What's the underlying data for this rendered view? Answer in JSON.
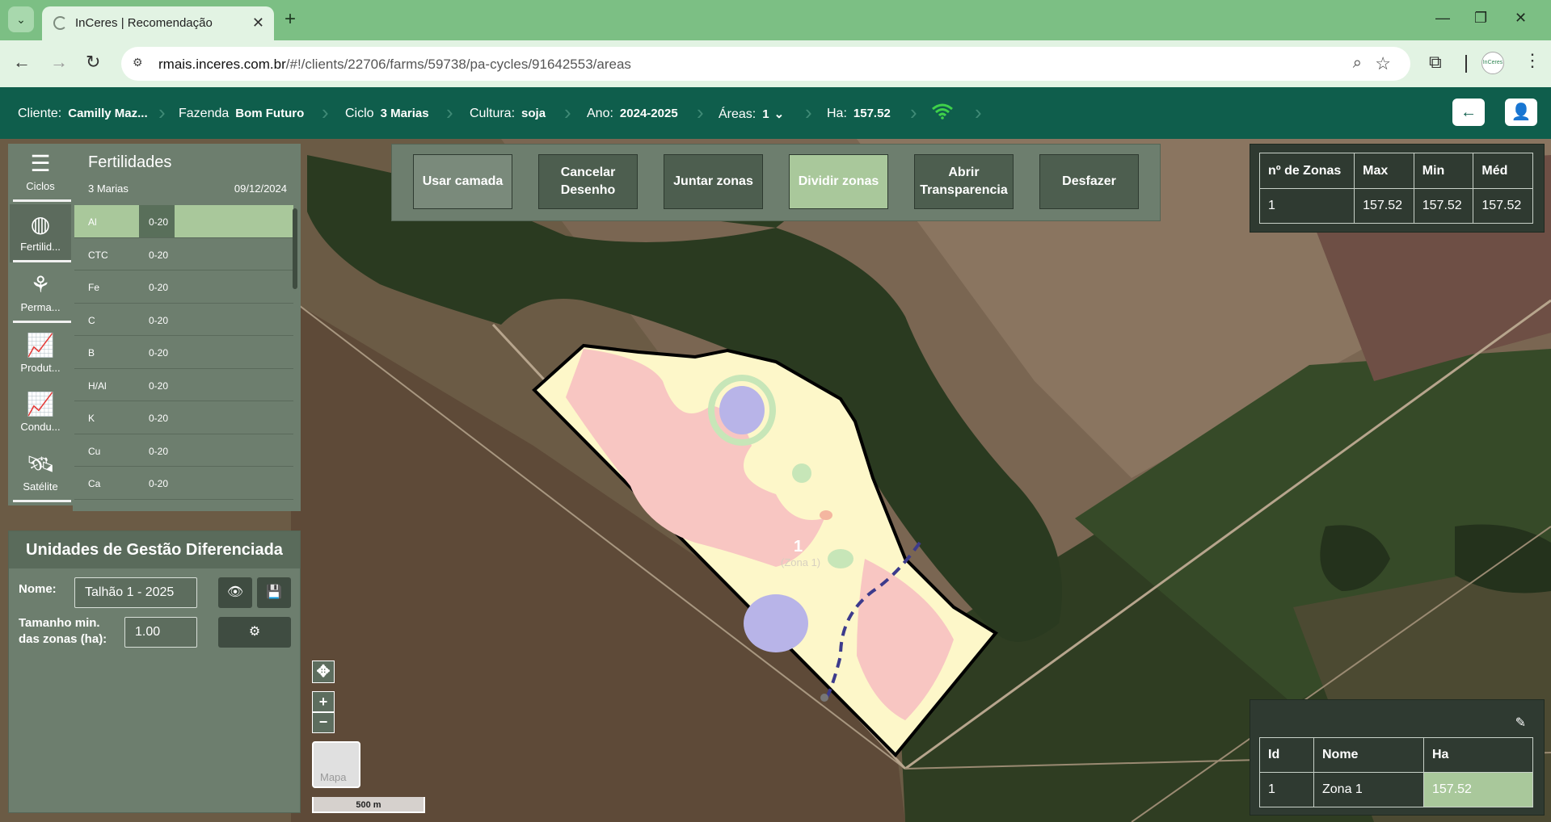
{
  "browser": {
    "tab_title": "InCeres | Recomendação",
    "url_host": "rmais.inceres.com.br",
    "url_path": "/#!/clients/22706/farms/59738/pa-cycles/91642553/areas",
    "profile_label": "InCeres"
  },
  "header": {
    "cliente_label": "Cliente:",
    "cliente_value": "Camilly Maz...",
    "fazenda_label": "Fazenda",
    "fazenda_value": "Bom Futuro",
    "ciclo_label": "Ciclo",
    "ciclo_value": "3 Marias",
    "cultura_label": "Cultura:",
    "cultura_value": "soja",
    "ano_label": "Ano:",
    "ano_value": "2024-2025",
    "areas_label": "Áreas:",
    "areas_value": "1",
    "ha_label": "Ha:",
    "ha_value": "157.52"
  },
  "sidebar": {
    "items": [
      {
        "label": "Ciclos",
        "icon": "list-icon"
      },
      {
        "label": "Fertilid...",
        "icon": "leaf-globe-icon"
      },
      {
        "label": "Perma...",
        "icon": "plants-icon"
      },
      {
        "label": "Produt...",
        "icon": "trend-chart-icon"
      },
      {
        "label": "Condu...",
        "icon": "trend-chart-icon"
      },
      {
        "label": "Satélite",
        "icon": "satellite-icon"
      }
    ]
  },
  "fertilidades": {
    "title": "Fertilidades",
    "subtitle": "3 Marias",
    "date": "09/12/2024",
    "rows": [
      {
        "name": "Al",
        "depth": "0-20"
      },
      {
        "name": "CTC",
        "depth": "0-20"
      },
      {
        "name": "Fe",
        "depth": "0-20"
      },
      {
        "name": "C",
        "depth": "0-20"
      },
      {
        "name": "B",
        "depth": "0-20"
      },
      {
        "name": "H/Al",
        "depth": "0-20"
      },
      {
        "name": "K",
        "depth": "0-20"
      },
      {
        "name": "Cu",
        "depth": "0-20"
      },
      {
        "name": "Ca",
        "depth": "0-20"
      }
    ]
  },
  "toolbar": {
    "usar_camada": "Usar camada",
    "cancelar_desenho": "Cancelar Desenho",
    "juntar_zonas": "Juntar zonas",
    "dividir_zonas": "Dividir zonas",
    "abrir_transparencia": "Abrir Transparencia",
    "desfazer": "Desfazer"
  },
  "stats": {
    "headers": [
      "nº de Zonas",
      "Max",
      "Min",
      "Méd"
    ],
    "row": [
      "1",
      "157.52",
      "157.52",
      "157.52"
    ]
  },
  "ugd": {
    "title": "Unidades de Gestão Diferenciada",
    "nome_label": "Nome:",
    "nome_value": "Talhão 1 - 2025",
    "tamanho_label_1": "Tamanho min.",
    "tamanho_label_2": "das zonas (ha):",
    "tamanho_value": "1.00"
  },
  "map": {
    "zone_number": "1",
    "zone_label": "(Zona 1)",
    "minimap_label": "Mapa",
    "scale_label": "500 m"
  },
  "zones_table": {
    "headers": [
      "Id",
      "Nome",
      "Ha"
    ],
    "row": [
      "1",
      "Zona 1",
      "157.52"
    ]
  },
  "colors": {
    "header_bg": "#0f5e4c",
    "panel_bg": "#6d7e6e",
    "accent_green": "#a9c89b",
    "tab_strip": "#7cbf84"
  }
}
